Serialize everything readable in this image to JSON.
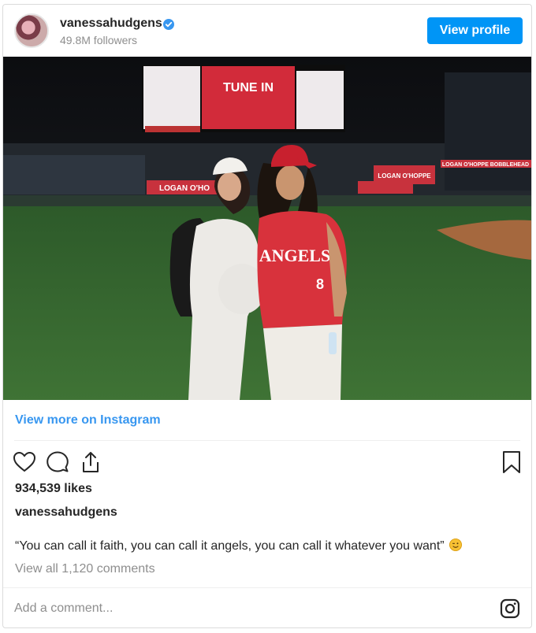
{
  "header": {
    "username": "vanessahudgens",
    "followers": "49.8M followers",
    "view_profile_label": "View profile"
  },
  "photo": {
    "scoreboard_center": "TUNE IN",
    "banner_left": "LOGAN O'HO",
    "banner_right": "LOGAN O'HOPPE",
    "banner_far_right": "LOGAN O'HOPPE BOBBLEHEAD",
    "jersey_text": "ANGELS",
    "jersey_number": "8"
  },
  "view_more_label": "View more on Instagram",
  "likes": "934,539 likes",
  "caption": {
    "username": "vanessahudgens",
    "text": "“You can call it faith, you can call it angels, you can call it whatever you want”"
  },
  "comments_link": "View all 1,120 comments",
  "add_comment_placeholder": "Add a comment...",
  "icons": {
    "like": "heart-icon",
    "comment": "comment-icon",
    "share": "share-icon",
    "save": "bookmark-icon",
    "instagram": "instagram-icon",
    "verified": "verified-badge-icon"
  },
  "colors": {
    "accent": "#0095f6",
    "link": "#3897f0",
    "muted": "#8e8e8e"
  }
}
